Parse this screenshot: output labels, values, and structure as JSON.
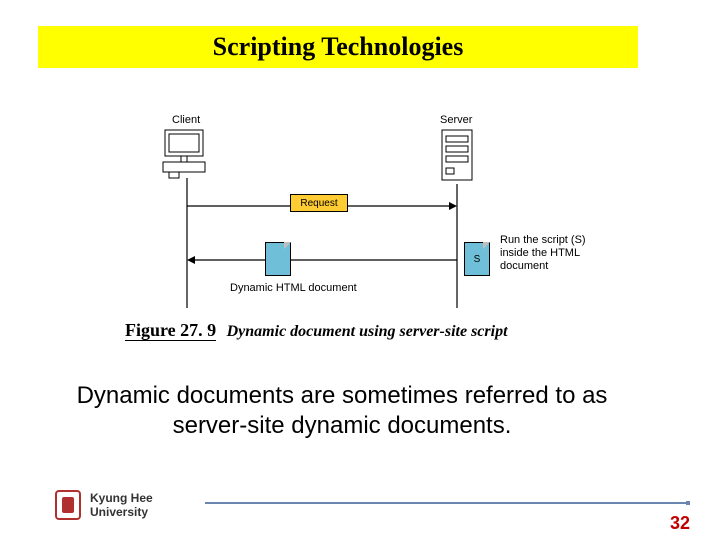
{
  "title": "Scripting Technologies",
  "diagram": {
    "client_label": "Client",
    "server_label": "Server",
    "request_label": "Request",
    "dynamic_doc_label": "Dynamic HTML document",
    "script_doc_letter": "S",
    "annotation_line1": "Run the script (S)",
    "annotation_line2": "inside the HTML",
    "annotation_line3": "document"
  },
  "caption": {
    "fig_no": "Figure 27. 9",
    "fig_title": "Dynamic document using server-site script"
  },
  "summary": "Dynamic documents are sometimes referred to as server-site dynamic documents.",
  "footer": {
    "uni_line1": "Kyung Hee",
    "uni_line2": "University",
    "page_number": "32"
  }
}
